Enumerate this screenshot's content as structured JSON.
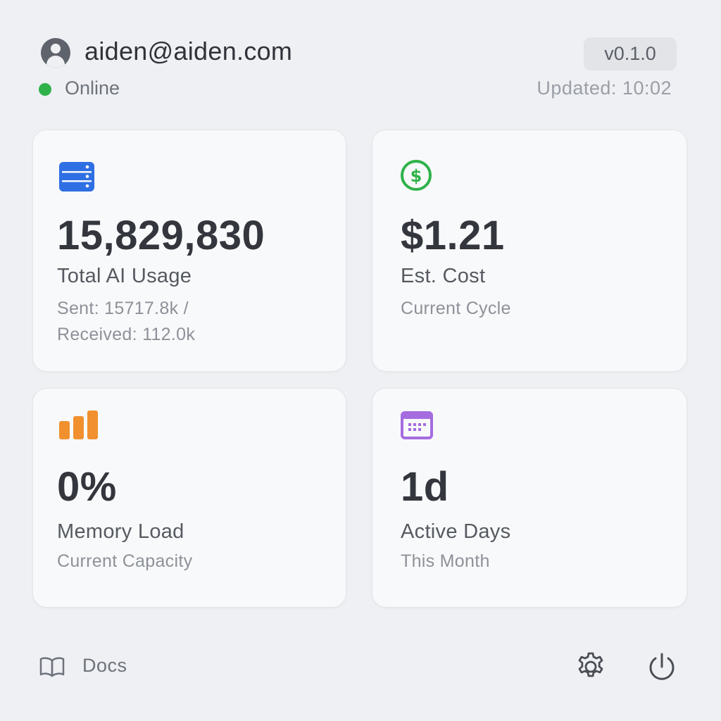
{
  "header": {
    "email": "aiden@aiden.com",
    "status": "Online",
    "version": "v0.1.0",
    "updated": "Updated: 10:02"
  },
  "cards": {
    "usage": {
      "value": "15,829,830",
      "label": "Total AI Usage",
      "sub_line1": "Sent: 15717.8k /",
      "sub_line2": "Received: 112.0k",
      "icon": "server-icon",
      "color": "#2f6fe4"
    },
    "cost": {
      "value": "$1.21",
      "label": "Est. Cost",
      "sub": "Current Cycle",
      "icon": "dollar-icon",
      "color": "#2fb24a"
    },
    "memory": {
      "value": "0%",
      "label": "Memory Load",
      "sub": "Current Capacity",
      "icon": "bar-chart-icon",
      "color": "#f0902f"
    },
    "days": {
      "value": "1d",
      "label": "Active Days",
      "sub": "This Month",
      "icon": "calendar-icon",
      "color": "#a56ce0"
    }
  },
  "footer": {
    "docs_label": "Docs",
    "settings_icon": "gear-icon",
    "power_icon": "power-icon"
  }
}
